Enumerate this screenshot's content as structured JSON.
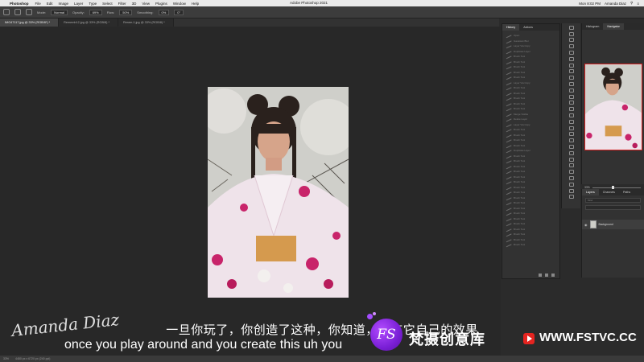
{
  "menubar": {
    "app": "Photoshop",
    "items": [
      "File",
      "Edit",
      "Image",
      "Layer",
      "Type",
      "Select",
      "Filter",
      "3D",
      "View",
      "Plugins",
      "Window",
      "Help"
    ],
    "clock": "Mon 8:02 PM",
    "user": "Amanda Diaz"
  },
  "window_title": "Adobe Photoshop 2021",
  "options": {
    "mode_label": "Mode:",
    "mode_value": "Normal",
    "opacity_label": "Opacity:",
    "opacity_value": "69%",
    "flow_label": "Flow:",
    "flow_value": "50%",
    "smoothing_label": "Smoothing:",
    "smoothing_value": "0%",
    "angle_value": "0°"
  },
  "tabs": [
    {
      "label": "IMG47117.jpg @ 33% (RGB/8*) *"
    },
    {
      "label": "Rememb12.jpg @ 33% (RGB/8) *"
    },
    {
      "label": "Renee-1.jpg @ 33% (RGB/8) *"
    }
  ],
  "history": {
    "tabs": [
      "History",
      "Actions"
    ],
    "items": [
      "Open",
      "Gaussian Blur",
      "Layer Via Copy",
      "Duplicate Layer",
      "Brush Tool",
      "Brush Tool",
      "Brush Tool",
      "Brush Tool",
      "Brush Tool",
      "Layer Via Copy",
      "Brush Tool",
      "Brush Tool",
      "Brush Tool",
      "Brush Tool",
      "Brush Tool",
      "Merge Visible",
      "Delete Layer",
      "Layer Via Copy",
      "Brush Tool",
      "Brush Tool",
      "Brush Tool",
      "Brush Tool",
      "Duplicate Layer",
      "Brush Tool",
      "Brush Tool",
      "Brush Tool",
      "Brush Tool",
      "Brush Tool",
      "Brush Tool",
      "Brush Tool",
      "Brush Tool",
      "Brush Tool",
      "Brush Tool",
      "Brush Tool",
      "Brush Tool",
      "Brush Tool",
      "Brush Tool",
      "Brush Tool",
      "Brush Tool",
      "Brush Tool",
      "Brush Tool"
    ]
  },
  "navigator": {
    "tabs": [
      "Histogram",
      "Navigator"
    ],
    "zoom": "33%"
  },
  "layers": {
    "tabs": [
      "Layers",
      "Channels",
      "Paths"
    ],
    "kind_label": "Kind",
    "layer_name": "Background"
  },
  "status": {
    "zoom": "33%",
    "doc": "4480 px x 6720 px (240 ppi)"
  },
  "subtitles": {
    "cn": "一旦你玩了，你创造了这种，你知道，它有它自己的效果",
    "en": "once you play around and you create this uh you"
  },
  "signature": "Amanda Diaz",
  "watermark": {
    "logo": "FS",
    "name_cn": "梵摄创意库",
    "url": "WWW.FSTVC.CC"
  }
}
